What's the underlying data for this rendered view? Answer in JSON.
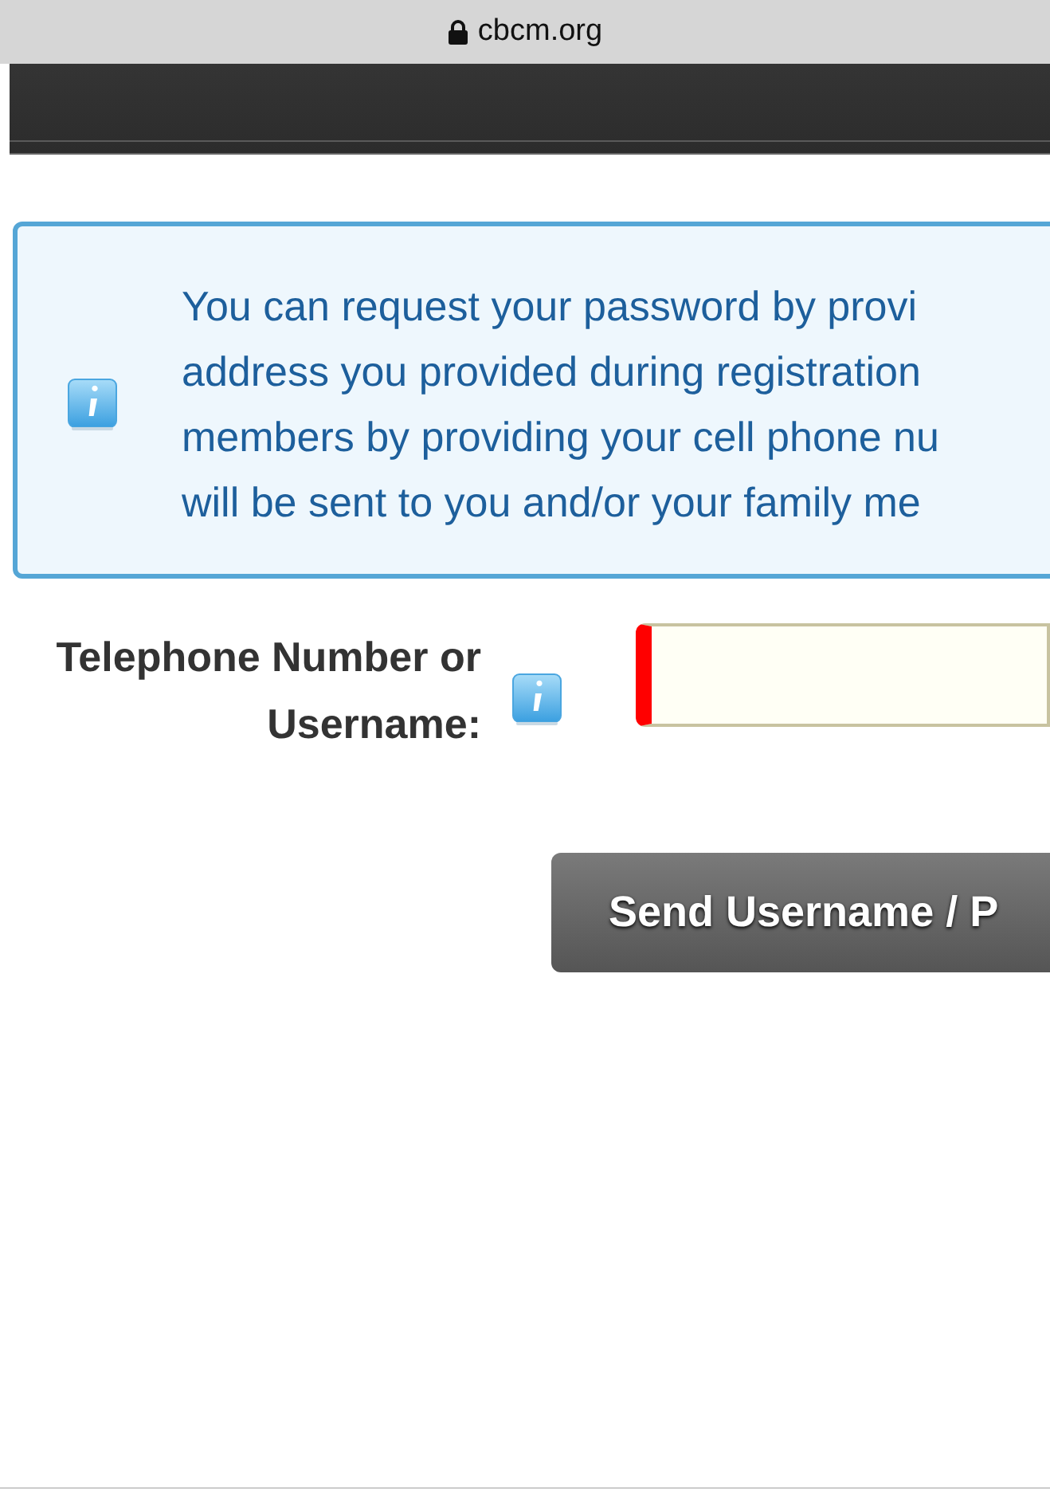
{
  "browser_bar": {
    "url": "cbcm.org"
  },
  "notice": {
    "lines": [
      "You can request your password by provi",
      "address you provided during registration",
      "members by providing your cell phone nu",
      "will be sent to you and/or your family me"
    ]
  },
  "form": {
    "label_lines": [
      "Telephone Number or",
      "Username:"
    ],
    "field": {
      "invalid": true
    }
  },
  "buttons": [
    "Send Username / P"
  ]
}
